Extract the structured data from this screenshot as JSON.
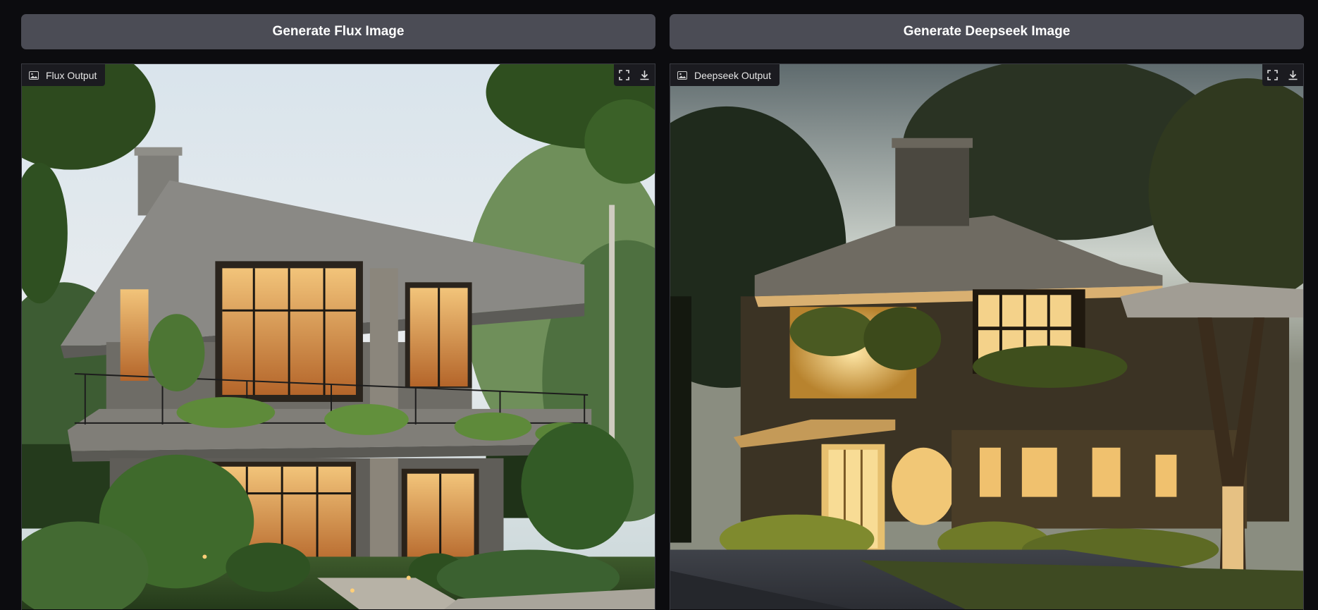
{
  "buttons": {
    "flux": "Generate Flux Image",
    "deepseek": "Generate Deepseek Image"
  },
  "panels": {
    "flux": {
      "label": "Flux Output",
      "icon": "image-icon"
    },
    "deepseek": {
      "label": "Deepseek Output",
      "icon": "image-icon"
    }
  },
  "toolbar_icons": [
    "fullscreen-icon",
    "download-icon"
  ],
  "colors": {
    "background": "#0c0c0f",
    "button": "#4b4c55",
    "panel_border": "#3a3b42",
    "label_bg": "#1b1b20"
  }
}
